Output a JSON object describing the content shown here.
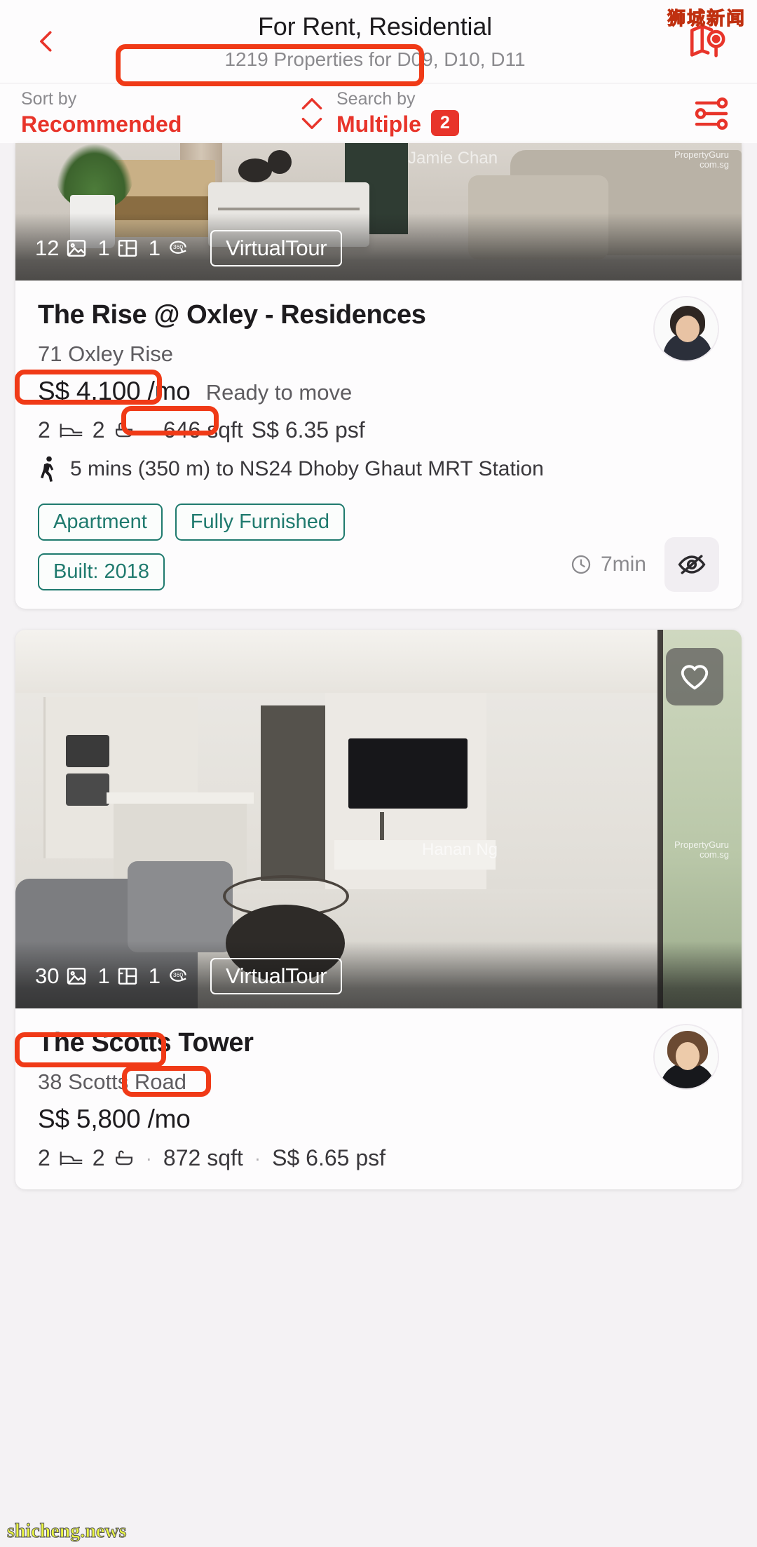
{
  "watermarks": {
    "top_right": "狮城新闻",
    "bottom_left": "shicheng.news"
  },
  "header": {
    "back_icon": "chevron-left-icon",
    "title": "For Rent, Residential",
    "subtitle": "1219 Properties for D09, D10, D11",
    "map_icon": "map-pin-icon"
  },
  "filterbar": {
    "sort_label": "Sort by",
    "sort_value": "Recommended",
    "updown_icon": "chevron-up-down-icon",
    "search_label": "Search by",
    "search_value": "Multiple",
    "search_count": "2",
    "settings_icon": "sliders-icon"
  },
  "colors": {
    "accent_red": "#e8342a",
    "highlight_red": "#f03a17",
    "tag_teal": "#1f7a6e",
    "text_dark": "#1d1b1e",
    "text_muted": "#8b8a8e"
  },
  "listings": [
    {
      "media": {
        "photo_count": "12",
        "photo_icon": "photo-icon",
        "floorplan_count": "1",
        "floorplan_icon": "floorplan-icon",
        "view360_count": "1",
        "view360_icon": "360-icon",
        "virtual_tour_label": "VirtualTour",
        "agent_watermark": "Jamie Chan",
        "site_watermark": "PropertyGuru",
        "site_watermark_sub": "com.sg"
      },
      "title": "The Rise @ Oxley - Residences",
      "address": "71 Oxley Rise",
      "price": "S$ 4,100 /mo",
      "availability": "Ready to move",
      "beds": "2",
      "baths": "2",
      "area": "646 sqft",
      "psf": "S$ 6.35 psf",
      "transit_icon": "walking-icon",
      "transit": "5 mins (350 m) to NS24 Dhoby Ghaut MRT Station",
      "tags": [
        "Apartment",
        "Fully Furnished",
        "Built: 2018"
      ],
      "time_icon": "clock-icon",
      "time": "7min",
      "hide_icon": "eye-off-icon",
      "agent_avatar": "agent-avatar"
    },
    {
      "media": {
        "photo_count": "30",
        "photo_icon": "photo-icon",
        "floorplan_count": "1",
        "floorplan_icon": "floorplan-icon",
        "view360_count": "1",
        "view360_icon": "360-icon",
        "virtual_tour_label": "VirtualTour",
        "agent_watermark": "Hanan Ng",
        "site_watermark": "PropertyGuru",
        "site_watermark_sub": "com.sg",
        "favourite_icon": "heart-icon"
      },
      "title": "The Scotts Tower",
      "address": "38 Scotts Road",
      "price": "S$ 5,800 /mo",
      "beds": "2",
      "baths": "2",
      "area": "872 sqft",
      "psf": "S$ 6.65 psf",
      "agent_avatar": "agent-avatar"
    }
  ]
}
